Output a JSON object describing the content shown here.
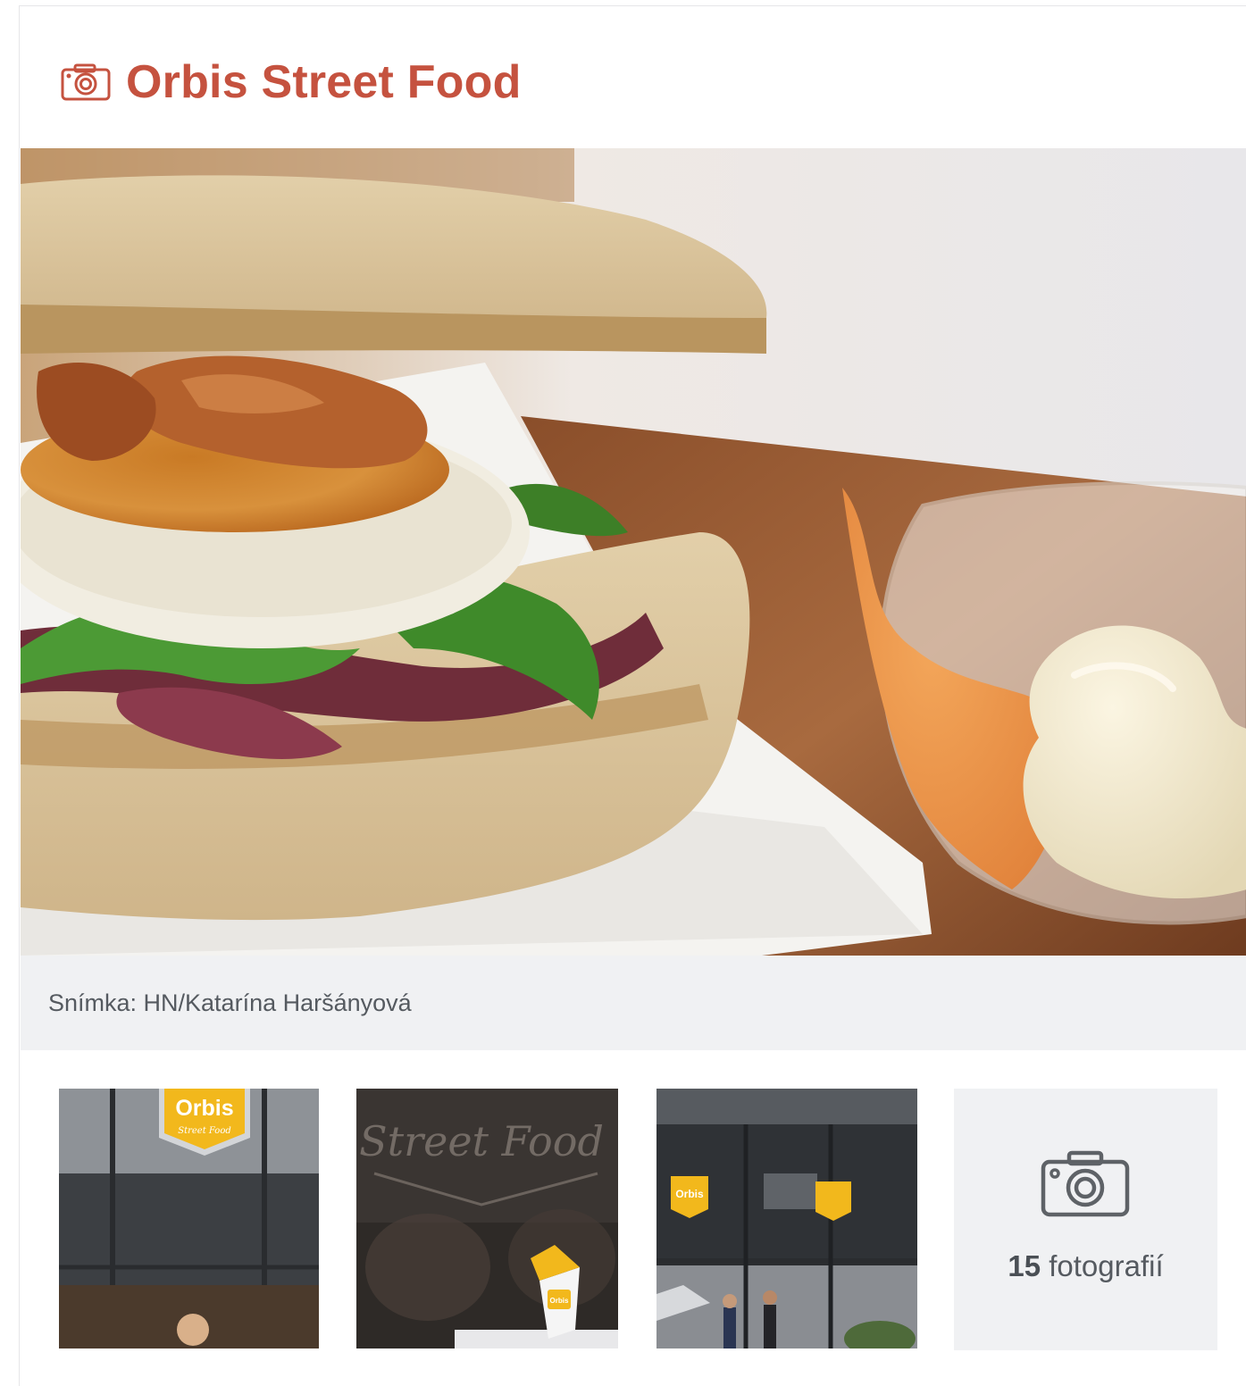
{
  "gallery": {
    "title": "Orbis Street Food",
    "title_icon": "camera-icon",
    "caption": "Snímka: HN/Katarína Haršányová",
    "thumbnails": [
      {
        "name": "thumb-storefront-sign",
        "logo_text": "Orbis",
        "logo_sub": "Street Food"
      },
      {
        "name": "thumb-takeaway-box",
        "sign_text": "Street Food",
        "box_text": "Orbis"
      },
      {
        "name": "thumb-street-facade",
        "sign_text": "Orbis"
      }
    ],
    "more": {
      "icon": "camera-icon",
      "count": "15",
      "label": "fotografií"
    }
  },
  "colors": {
    "title": "#c5523f",
    "caption_bar": "#f0f1f3",
    "caption_text": "#555a60",
    "logo_yellow": "#f2b81c"
  }
}
